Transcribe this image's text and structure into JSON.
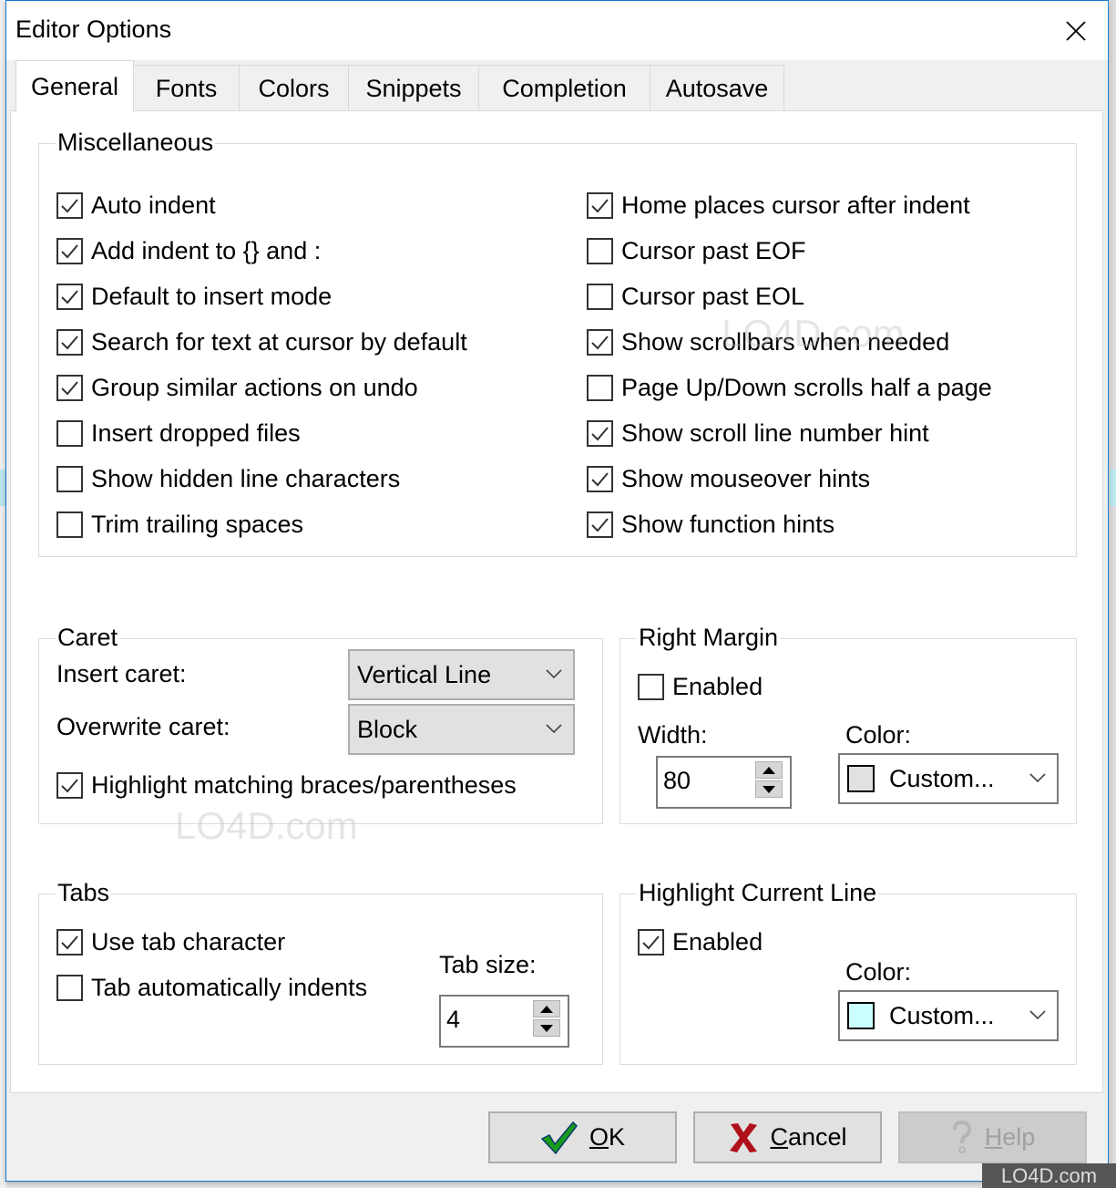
{
  "window": {
    "title": "Editor Options",
    "close_icon": "close-icon"
  },
  "tabs": [
    {
      "label": "General",
      "active": true
    },
    {
      "label": "Fonts",
      "active": false
    },
    {
      "label": "Colors",
      "active": false
    },
    {
      "label": "Snippets",
      "active": false
    },
    {
      "label": "Completion",
      "active": false
    },
    {
      "label": "Autosave",
      "active": false
    }
  ],
  "miscellaneous": {
    "title": "Miscellaneous",
    "left": [
      {
        "label": "Auto indent",
        "checked": true
      },
      {
        "label": "Add indent to {} and :",
        "checked": true
      },
      {
        "label": "Default to insert mode",
        "checked": true
      },
      {
        "label": "Search for text at cursor by default",
        "checked": true
      },
      {
        "label": "Group similar actions on undo",
        "checked": true
      },
      {
        "label": "Insert dropped files",
        "checked": false
      },
      {
        "label": "Show hidden line characters",
        "checked": false
      },
      {
        "label": "Trim trailing spaces",
        "checked": false
      }
    ],
    "right": [
      {
        "label": "Home places cursor after indent",
        "checked": true
      },
      {
        "label": "Cursor past EOF",
        "checked": false
      },
      {
        "label": "Cursor past EOL",
        "checked": false
      },
      {
        "label": "Show scrollbars when needed",
        "checked": true
      },
      {
        "label": "Page Up/Down scrolls half a page",
        "checked": false
      },
      {
        "label": "Show scroll line number hint",
        "checked": true
      },
      {
        "label": "Show mouseover hints",
        "checked": true
      },
      {
        "label": "Show function hints",
        "checked": true
      }
    ]
  },
  "caret": {
    "title": "Caret",
    "insert_label": "Insert caret:",
    "insert_value": "Vertical Line",
    "overwrite_label": "Overwrite caret:",
    "overwrite_value": "Block",
    "highlight_braces": {
      "label": "Highlight matching braces/parentheses",
      "checked": true
    }
  },
  "right_margin": {
    "title": "Right Margin",
    "enabled": {
      "label": "Enabled",
      "checked": false
    },
    "width_label": "Width:",
    "width_value": "80",
    "color_label": "Color:",
    "color_value": "Custom...",
    "color_swatch": "#e1e1e1"
  },
  "tabs_group": {
    "title": "Tabs",
    "use_tab": {
      "label": "Use tab character",
      "checked": true
    },
    "tab_indents": {
      "label": "Tab automatically indents",
      "checked": false
    },
    "tab_size_label": "Tab size:",
    "tab_size_value": "4"
  },
  "highlight_line": {
    "title": "Highlight Current Line",
    "enabled": {
      "label": "Enabled",
      "checked": true
    },
    "color_label": "Color:",
    "color_value": "Custom...",
    "color_swatch": "#ccffff"
  },
  "buttons": {
    "ok": {
      "mnemonic": "O",
      "rest": "K",
      "icon": "checkmark-icon",
      "icon_color": "#1a9a1a"
    },
    "cancel": {
      "mnemonic": "C",
      "rest": "ancel",
      "icon": "x-icon",
      "icon_color": "#b0101a"
    },
    "help": {
      "mnemonic": "H",
      "rest": "elp",
      "icon": "question-icon",
      "disabled": true
    }
  },
  "watermark": {
    "text": "LO4D.com"
  },
  "colors": {
    "window_border": "#1979ca",
    "dialog_bg": "#f0f0f0",
    "page_bg": "#ffffff"
  }
}
